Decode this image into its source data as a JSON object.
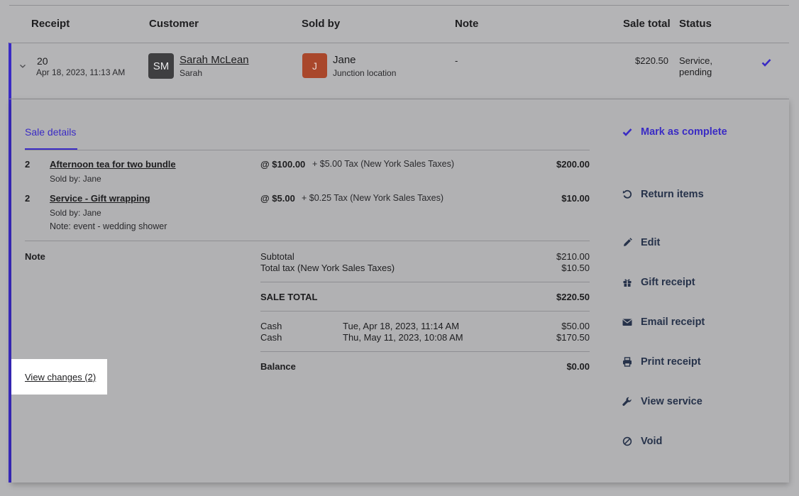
{
  "table": {
    "headers": {
      "receipt": "Receipt",
      "customer": "Customer",
      "sold_by": "Sold by",
      "note": "Note",
      "sale_total": "Sale total",
      "status": "Status"
    },
    "row": {
      "receipt_number": "20",
      "receipt_date": "Apr 18, 2023, 11:13 AM",
      "customer_initials": "SM",
      "customer_name": "Sarah McLean",
      "customer_first": "Sarah",
      "seller_initial": "J",
      "seller_name": "Jane",
      "seller_location": "Junction location",
      "note": "-",
      "sale_total": "$220.50",
      "status": "Service, pending"
    }
  },
  "details": {
    "tab_label": "Sale details",
    "items": [
      {
        "qty": "2",
        "name": "Afternoon tea for two bundle",
        "sold_by": "Sold by: Jane",
        "price": "@ $100.00",
        "tax": "+ $5.00 Tax (New York Sales Taxes)",
        "amount": "$200.00"
      },
      {
        "qty": "2",
        "name": "Service - Gift wrapping",
        "sold_by": "Sold by: Jane",
        "note": "Note: event - wedding shower",
        "price": "@ $5.00",
        "tax": "+ $0.25 Tax (New York Sales Taxes)",
        "amount": "$10.00"
      }
    ],
    "note_label": "Note",
    "subtotal_label": "Subtotal",
    "subtotal_value": "$210.00",
    "tax_label": "Total tax (New York Sales Taxes)",
    "tax_value": "$10.50",
    "sale_total_label": "SALE TOTAL",
    "sale_total_value": "$220.50",
    "payments": [
      {
        "method": "Cash",
        "date": "Tue, Apr 18, 2023, 11:14 AM",
        "amount": "$50.00"
      },
      {
        "method": "Cash",
        "date": "Thu, May 11, 2023, 10:08 AM",
        "amount": "$170.50"
      }
    ],
    "balance_label": "Balance",
    "balance_value": "$0.00",
    "view_changes": "View changes (2)"
  },
  "actions": {
    "mark_complete": "Mark as complete",
    "return_items": "Return items",
    "edit": "Edit",
    "gift_receipt": "Gift receipt",
    "email_receipt": "Email receipt",
    "print_receipt": "Print receipt",
    "view_service": "View service",
    "void": "Void"
  },
  "colors": {
    "accent": "#3a2bc4",
    "background": "#b4b4b6",
    "action_text": "#26324a"
  }
}
